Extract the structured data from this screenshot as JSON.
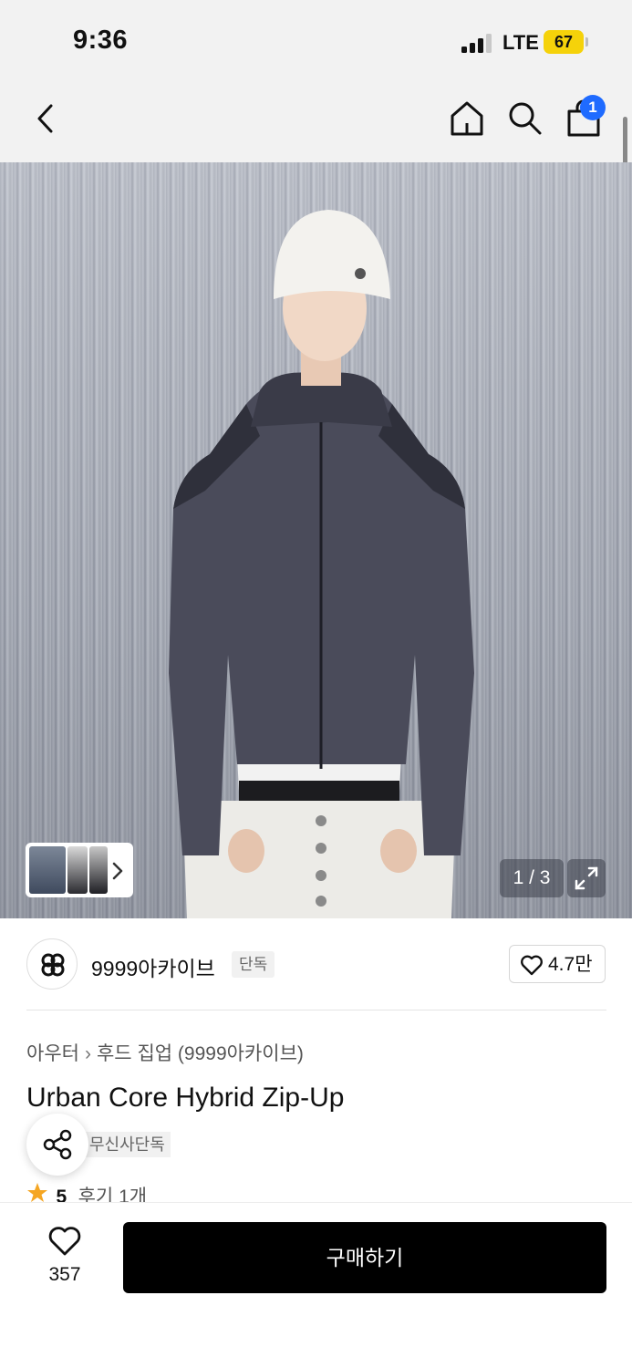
{
  "status_bar": {
    "time": "9:36",
    "network": "LTE",
    "battery": "67",
    "battery_color": "#f5d20a"
  },
  "nav": {
    "back_icon": "chevron-left-icon",
    "home_icon": "home-icon",
    "search_icon": "search-icon",
    "cart_icon": "shopping-bag-icon",
    "cart_badge": "1",
    "badge_color": "#1f6bff"
  },
  "gallery": {
    "counter": "1 / 3",
    "current_index": 1,
    "total": 3,
    "expand_icon": "expand-icon",
    "thumb_next_icon": "chevron-right-icon"
  },
  "brand": {
    "name": "9999아카이브",
    "tag": "단독",
    "like_count": "4.7만",
    "like_icon": "heart-outline-icon"
  },
  "product": {
    "breadcrumb": [
      "아우터",
      "후드 집업 (9999아카이브)"
    ],
    "title": "Urban Core Hybrid Zip-Up",
    "exclusive_tag": "무신사단독",
    "rating": "5",
    "reviews": "후기 1개",
    "star_color": "#f5a623"
  },
  "bottom_bar": {
    "wish_icon": "heart-outline-icon",
    "wish_count": "357",
    "buy_label": "구매하기"
  }
}
